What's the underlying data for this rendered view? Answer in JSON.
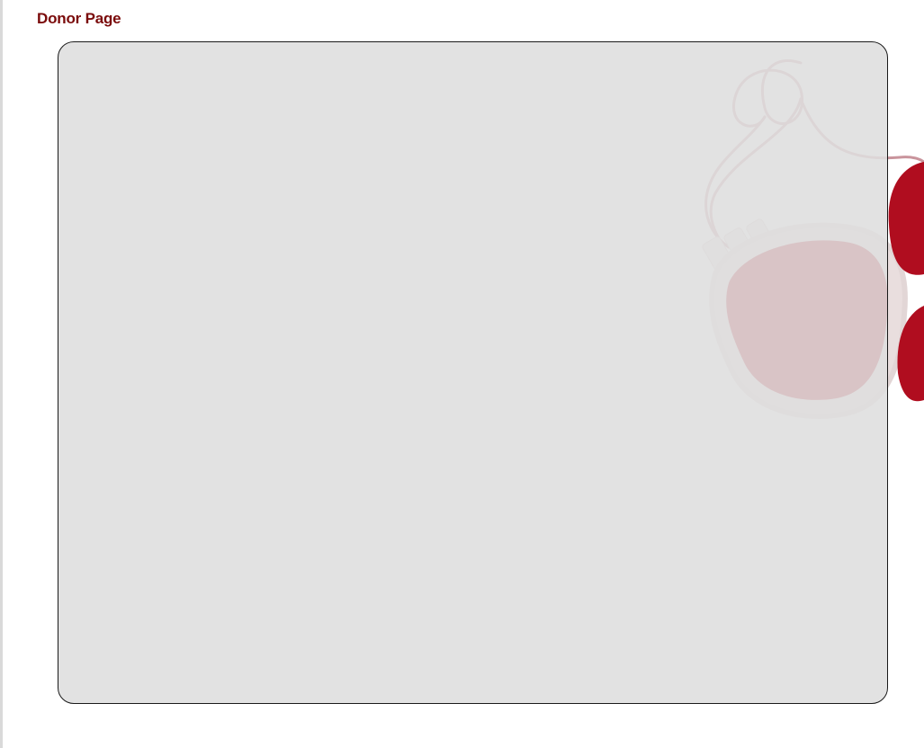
{
  "header": {
    "title": "Donor Page"
  },
  "theme": {
    "title_color": "#7a0a0a",
    "panel_background": "#dedede",
    "panel_border": "#1a1a1a",
    "blood_color": "#b00d1f"
  },
  "decoration": {
    "icon": "blood-bag-icon"
  }
}
